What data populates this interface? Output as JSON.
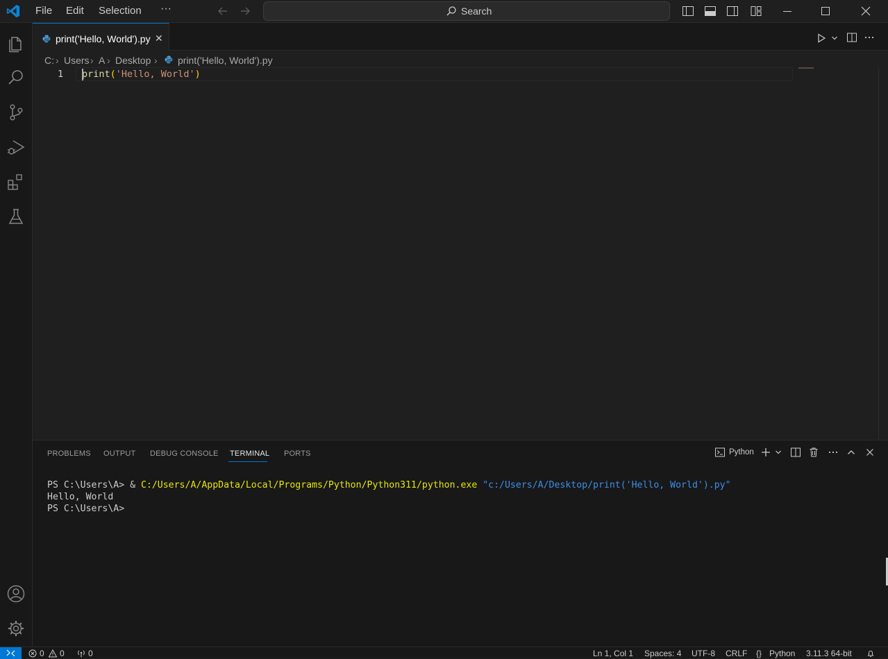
{
  "menu": {
    "file": "File",
    "edit": "Edit",
    "selection": "Selection",
    "more": "···"
  },
  "search": {
    "label": "Search"
  },
  "tab": {
    "label": "print('Hello, World').py",
    "close": "✕"
  },
  "breadcrumb": [
    "C:",
    "Users",
    "A",
    "Desktop",
    "print('Hello, World').py"
  ],
  "editor": {
    "line_number": "1",
    "code_fn": "print",
    "code_open": "(",
    "code_str": "'Hello, World'",
    "code_close": ")"
  },
  "panel": {
    "tabs": [
      "PROBLEMS",
      "OUTPUT",
      "DEBUG CONSOLE",
      "TERMINAL",
      "PORTS"
    ],
    "active_tab": "TERMINAL",
    "shell_label": "Python",
    "terminal": {
      "line1_prompt": "PS C:\\Users\\A> ",
      "line1_amp": "& ",
      "line1_exe": "C:/Users/A/AppData/Local/Programs/Python/Python311/python.exe",
      "line1_arg": " \"c:/Users/A/Desktop/print('Hello, World').py\"",
      "line2": "Hello, World",
      "line3": "PS C:\\Users\\A>"
    }
  },
  "status": {
    "errors": "0",
    "warnings": "0",
    "ports": "0",
    "position": "Ln 1, Col 1",
    "spaces": "Spaces: 4",
    "encoding": "UTF-8",
    "eol": "CRLF",
    "language": "Python",
    "interpreter": "3.11.3 64-bit"
  },
  "colors": {
    "accent": "#0078d4",
    "string": "#ce9178",
    "function": "#dcdcaa",
    "terminal_exe": "#e5e510",
    "terminal_arg": "#3b8eea"
  }
}
